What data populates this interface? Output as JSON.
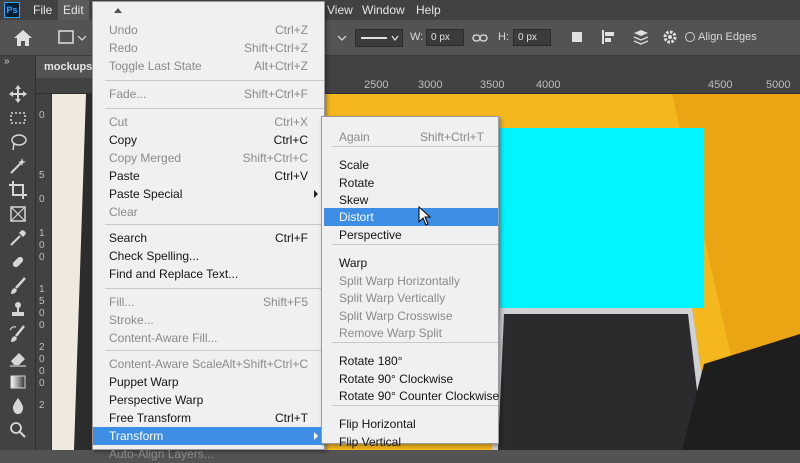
{
  "menubar": {
    "logo": "Ps",
    "items": [
      "File",
      "Edit",
      "View",
      "Window",
      "Help"
    ]
  },
  "options": {
    "w_label": "W:",
    "w_value": "0 px",
    "h_label": "H:",
    "h_value": "0 px",
    "align_edges": "Align Edges"
  },
  "document": {
    "tab": "mockups"
  },
  "ruler": {
    "top": [
      "2500",
      "3000",
      "3500",
      "4000",
      "4500",
      "5000"
    ],
    "left": [
      "0",
      "5",
      "0",
      "1",
      "0",
      "0",
      "1",
      "5",
      "0",
      "0",
      "2",
      "0",
      "0",
      "0",
      "2"
    ]
  },
  "edit_menu": {
    "rows": [
      {
        "label": "Undo",
        "shortcut": "Ctrl+Z",
        "enabled": false
      },
      {
        "label": "Redo",
        "shortcut": "Shift+Ctrl+Z",
        "enabled": false
      },
      {
        "label": "Toggle Last State",
        "shortcut": "Alt+Ctrl+Z",
        "enabled": false
      },
      {
        "label": "Fade...",
        "shortcut": "Shift+Ctrl+F",
        "enabled": false
      },
      {
        "label": "Cut",
        "shortcut": "Ctrl+X",
        "enabled": false
      },
      {
        "label": "Copy",
        "shortcut": "Ctrl+C",
        "enabled": true
      },
      {
        "label": "Copy Merged",
        "shortcut": "Shift+Ctrl+C",
        "enabled": false
      },
      {
        "label": "Paste",
        "shortcut": "Ctrl+V",
        "enabled": true
      },
      {
        "label": "Paste Special",
        "shortcut": "",
        "enabled": true
      },
      {
        "label": "Clear",
        "shortcut": "",
        "enabled": false
      },
      {
        "label": "Search",
        "shortcut": "Ctrl+F",
        "enabled": true
      },
      {
        "label": "Check Spelling...",
        "shortcut": "",
        "enabled": true
      },
      {
        "label": "Find and Replace Text...",
        "shortcut": "",
        "enabled": true
      },
      {
        "label": "Fill...",
        "shortcut": "Shift+F5",
        "enabled": false
      },
      {
        "label": "Stroke...",
        "shortcut": "",
        "enabled": false
      },
      {
        "label": "Content-Aware Fill...",
        "shortcut": "",
        "enabled": false
      },
      {
        "label": "Content-Aware Scale",
        "shortcut": "Alt+Shift+Ctrl+C",
        "enabled": false
      },
      {
        "label": "Puppet Warp",
        "shortcut": "",
        "enabled": true
      },
      {
        "label": "Perspective Warp",
        "shortcut": "",
        "enabled": true
      },
      {
        "label": "Free Transform",
        "shortcut": "Ctrl+T",
        "enabled": true
      },
      {
        "label": "Transform",
        "shortcut": "",
        "enabled": true
      },
      {
        "label": "Auto-Align Layers...",
        "shortcut": "",
        "enabled": false
      }
    ]
  },
  "transform_menu": {
    "rows": [
      {
        "label": "Again",
        "shortcut": "Shift+Ctrl+T",
        "enabled": false
      },
      {
        "label": "Scale",
        "shortcut": "",
        "enabled": true
      },
      {
        "label": "Rotate",
        "shortcut": "",
        "enabled": true
      },
      {
        "label": "Skew",
        "shortcut": "",
        "enabled": true
      },
      {
        "label": "Distort",
        "shortcut": "",
        "enabled": true
      },
      {
        "label": "Perspective",
        "shortcut": "",
        "enabled": true
      },
      {
        "label": "Warp",
        "shortcut": "",
        "enabled": true
      },
      {
        "label": "Split Warp Horizontally",
        "shortcut": "",
        "enabled": false
      },
      {
        "label": "Split Warp Vertically",
        "shortcut": "",
        "enabled": false
      },
      {
        "label": "Split Warp Crosswise",
        "shortcut": "",
        "enabled": false
      },
      {
        "label": "Remove Warp Split",
        "shortcut": "",
        "enabled": false
      },
      {
        "label": "Rotate 180°",
        "shortcut": "",
        "enabled": true
      },
      {
        "label": "Rotate 90° Clockwise",
        "shortcut": "",
        "enabled": true
      },
      {
        "label": "Rotate 90° Counter Clockwise",
        "shortcut": "",
        "enabled": true
      },
      {
        "label": "Flip Horizontal",
        "shortcut": "",
        "enabled": true
      },
      {
        "label": "Flip Vertical",
        "shortcut": "",
        "enabled": true
      }
    ]
  },
  "colors": {
    "highlight": "#3f8ee6",
    "canvas_bg": "#f4b81e",
    "cyan_rect": "#00f5ff"
  }
}
